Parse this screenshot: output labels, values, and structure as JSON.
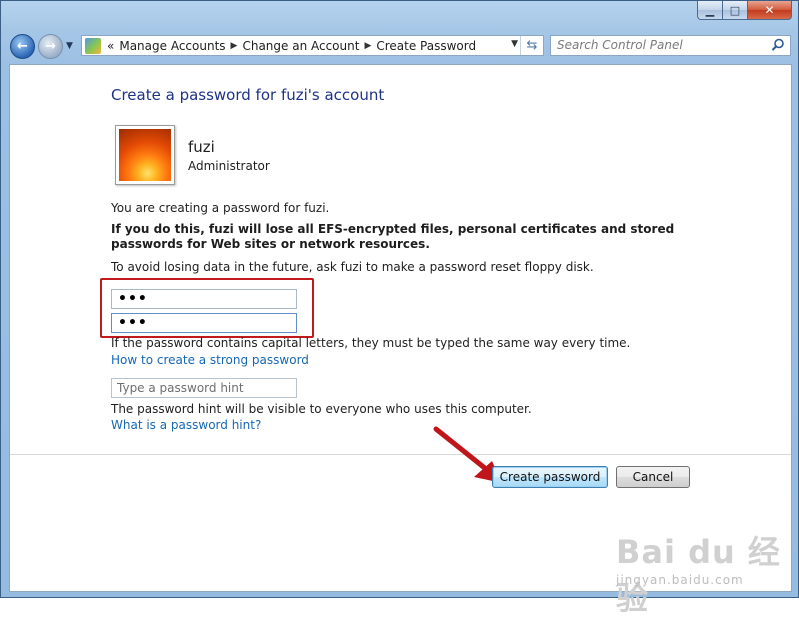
{
  "window": {
    "caption_buttons": {
      "minimize": "minimize-icon",
      "maximize": "maximize-icon",
      "close": "close-icon"
    }
  },
  "nav": {
    "back_icon": "back-arrow-icon",
    "forward_icon": "forward-arrow-icon",
    "breadcrumb": [
      "Manage Accounts",
      "Change an Account",
      "Create Password"
    ],
    "breadcrumb_prefix": "«",
    "search_placeholder": "Search Control Panel"
  },
  "main": {
    "title": "Create a password for fuzi's account",
    "user": {
      "name": "fuzi",
      "role": "Administrator"
    },
    "intro": "You are creating a password for fuzi.",
    "warning": "If you do this, fuzi will lose all EFS-encrypted files, personal certificates and stored passwords for Web sites or network resources.",
    "advice": "To avoid losing data in the future, ask fuzi to make a password reset floppy disk.",
    "new_password_value": "•••",
    "confirm_password_value": "•••",
    "caps_note": "If the password contains capital letters, they must be typed the same way every time.",
    "strong_password_link": "How to create a strong password",
    "hint_placeholder": "Type a password hint",
    "hint_note": "The password hint will be visible to everyone who uses this computer.",
    "hint_link": "What is a password hint?"
  },
  "buttons": {
    "create": "Create password",
    "cancel": "Cancel"
  },
  "watermark": {
    "main": "Bai du 经验",
    "sub": "jingyan.baidu.com"
  },
  "colors": {
    "title": "#1e3287",
    "link": "#1667b5",
    "highlight": "#c21a1a",
    "frame": "#a5c6e6"
  }
}
